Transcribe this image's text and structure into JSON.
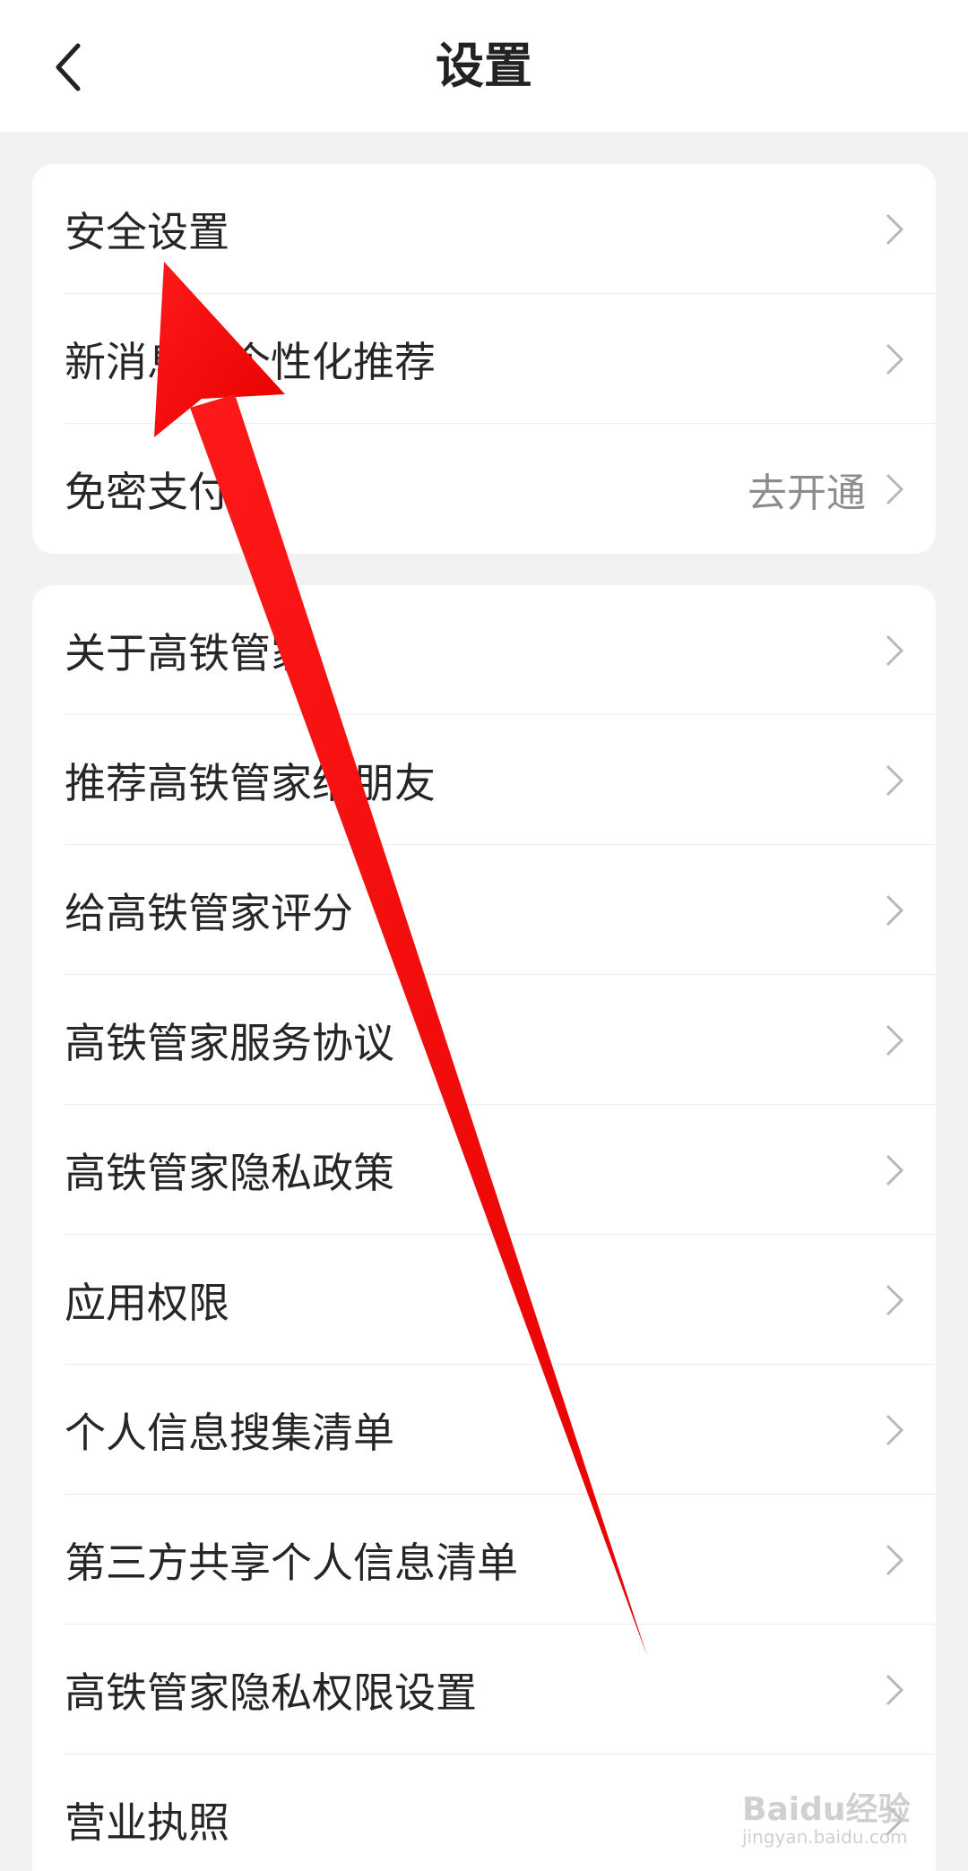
{
  "header": {
    "title": "设置",
    "back_icon": "chevron-left-icon"
  },
  "group1": {
    "items": [
      {
        "label": "安全设置",
        "value": ""
      },
      {
        "label": "新消息与个性化推荐",
        "value": ""
      },
      {
        "label": "免密支付",
        "value": "去开通"
      }
    ]
  },
  "group2": {
    "items": [
      {
        "label": "关于高铁管家"
      },
      {
        "label": "推荐高铁管家给朋友"
      },
      {
        "label": "给高铁管家评分"
      },
      {
        "label": "高铁管家服务协议"
      },
      {
        "label": "高铁管家隐私政策"
      },
      {
        "label": "应用权限"
      },
      {
        "label": "个人信息搜集清单"
      },
      {
        "label": "第三方共享个人信息清单"
      },
      {
        "label": "高铁管家隐私权限设置"
      },
      {
        "label": "营业执照"
      }
    ]
  },
  "overlay": {
    "arrow_color": "#ff0000",
    "watermark_main": "Baidu经验",
    "watermark_sub": "jingyan.baidu.com"
  },
  "colors": {
    "background": "#f2f2f2",
    "card": "#ffffff",
    "chevron": "#b8b8b8",
    "value_text": "#8c8c8c"
  }
}
